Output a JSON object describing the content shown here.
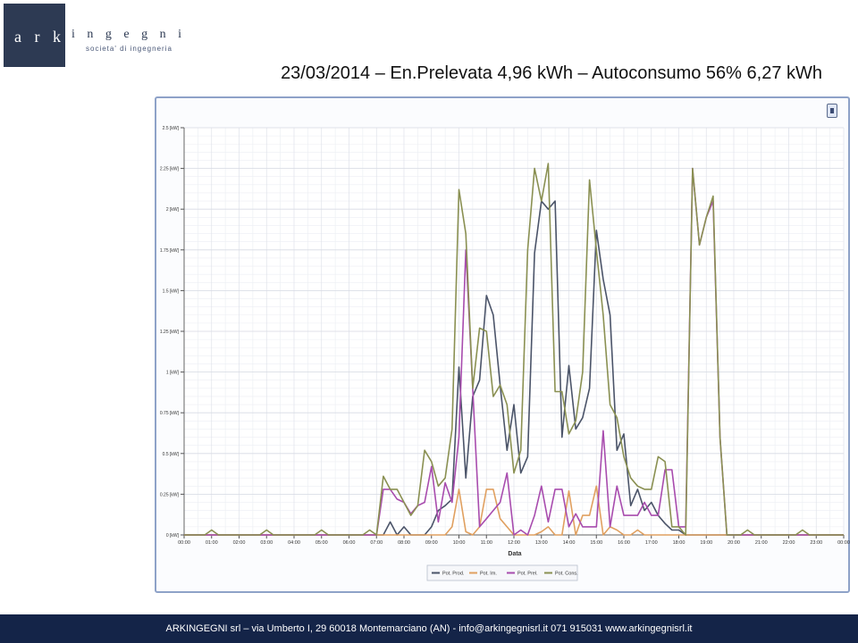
{
  "logo": {
    "text_ark": "a r k",
    "text_ingegni": "i n g e g n i",
    "subtitle": "societa' di ingegneria"
  },
  "title": "23/03/2014 – En.Prelevata 4,96 kWh – Autoconsumo 56% 6,27 kWh",
  "footer": "ARKINGEGNI srl – via Umberto I, 29 60018 Montemarciano (AN) - info@arkingegnisrl.it 071 915031 www.arkingegnisrl.it",
  "chart_data": {
    "type": "line",
    "xlabel": "Data",
    "ylabel": "",
    "ylim": [
      0,
      2.5
    ],
    "xlim": [
      0,
      24
    ],
    "grid": true,
    "legend_position": "bottom-center",
    "x_ticks": [
      "00:00",
      "01:00",
      "02:00",
      "03:00",
      "04:00",
      "05:00",
      "06:00",
      "07:00",
      "08:00",
      "09:00",
      "10:00",
      "11:00",
      "12:00",
      "13:00",
      "14:00",
      "15:00",
      "16:00",
      "17:00",
      "18:00",
      "19:00",
      "20:00",
      "21:00",
      "22:00",
      "23:00",
      "00:00"
    ],
    "y_ticks": [
      {
        "value": 0,
        "label": "0 [kW]"
      },
      {
        "value": 0.25,
        "label": "0.25 [kW]"
      },
      {
        "value": 0.5,
        "label": "0.5 [kW]"
      },
      {
        "value": 0.75,
        "label": "0.75 [kW]"
      },
      {
        "value": 1,
        "label": "1 [kW]"
      },
      {
        "value": 1.25,
        "label": "1.25 [kW]"
      },
      {
        "value": 1.5,
        "label": "1.5 [kW]"
      },
      {
        "value": 1.75,
        "label": "1.75 [kW]"
      },
      {
        "value": 2,
        "label": "2 [kW]"
      },
      {
        "value": 2.25,
        "label": "2.25 [kW]"
      },
      {
        "value": 2.5,
        "label": "2.5 [kW]"
      }
    ],
    "series": [
      {
        "name": "Pot. Prod.",
        "color": "#4b5469",
        "points": [
          [
            0,
            0
          ],
          [
            7,
            0
          ],
          [
            7.25,
            0
          ],
          [
            7.5,
            0.08
          ],
          [
            7.75,
            0
          ],
          [
            8,
            0.05
          ],
          [
            8.25,
            0
          ],
          [
            8.5,
            0
          ],
          [
            8.75,
            0
          ],
          [
            9,
            0.05
          ],
          [
            9.25,
            0.15
          ],
          [
            9.5,
            0.18
          ],
          [
            9.75,
            0.22
          ],
          [
            10,
            1.03
          ],
          [
            10.25,
            0.35
          ],
          [
            10.5,
            0.85
          ],
          [
            10.75,
            0.95
          ],
          [
            11,
            1.47
          ],
          [
            11.25,
            1.35
          ],
          [
            11.5,
            0.92
          ],
          [
            11.75,
            0.52
          ],
          [
            12,
            0.8
          ],
          [
            12.25,
            0.38
          ],
          [
            12.5,
            0.48
          ],
          [
            12.75,
            1.73
          ],
          [
            13,
            2.05
          ],
          [
            13.25,
            2.0
          ],
          [
            13.5,
            2.05
          ],
          [
            13.75,
            0.6
          ],
          [
            14,
            1.04
          ],
          [
            14.25,
            0.65
          ],
          [
            14.5,
            0.72
          ],
          [
            14.75,
            0.9
          ],
          [
            15,
            1.87
          ],
          [
            15.25,
            1.57
          ],
          [
            15.5,
            1.35
          ],
          [
            15.75,
            0.52
          ],
          [
            16,
            0.62
          ],
          [
            16.25,
            0.18
          ],
          [
            16.5,
            0.28
          ],
          [
            16.75,
            0.15
          ],
          [
            17,
            0.2
          ],
          [
            17.25,
            0.12
          ],
          [
            17.5,
            0.07
          ],
          [
            17.75,
            0.03
          ],
          [
            18,
            0.03
          ],
          [
            18.25,
            0
          ],
          [
            24,
            0
          ]
        ]
      },
      {
        "name": "Pot. Im.",
        "color": "#e0a060",
        "points": [
          [
            0,
            0
          ],
          [
            9.5,
            0
          ],
          [
            9.75,
            0.05
          ],
          [
            10,
            0.28
          ],
          [
            10.25,
            0.02
          ],
          [
            10.5,
            0
          ],
          [
            10.75,
            0.05
          ],
          [
            11,
            0.28
          ],
          [
            11.25,
            0.28
          ],
          [
            11.5,
            0.1
          ],
          [
            11.75,
            0.05
          ],
          [
            12,
            0
          ],
          [
            12.25,
            0
          ],
          [
            12.5,
            0
          ],
          [
            12.75,
            0
          ],
          [
            13,
            0.02
          ],
          [
            13.25,
            0.05
          ],
          [
            13.5,
            0
          ],
          [
            13.75,
            0
          ],
          [
            14,
            0.27
          ],
          [
            14.25,
            0
          ],
          [
            14.5,
            0.12
          ],
          [
            14.75,
            0.12
          ],
          [
            15,
            0.3
          ],
          [
            15.25,
            0
          ],
          [
            15.5,
            0.05
          ],
          [
            15.75,
            0.03
          ],
          [
            16,
            0
          ],
          [
            16.25,
            0
          ],
          [
            16.5,
            0.03
          ],
          [
            16.75,
            0
          ],
          [
            17,
            0
          ],
          [
            24,
            0
          ]
        ]
      },
      {
        "name": "Pot. Prel.",
        "color": "#a84cae",
        "points": [
          [
            0,
            0
          ],
          [
            7,
            0
          ],
          [
            7.25,
            0.28
          ],
          [
            7.5,
            0.28
          ],
          [
            7.75,
            0.22
          ],
          [
            8,
            0.2
          ],
          [
            8.25,
            0.13
          ],
          [
            8.5,
            0.18
          ],
          [
            8.75,
            0.2
          ],
          [
            9,
            0.42
          ],
          [
            9.25,
            0.08
          ],
          [
            9.5,
            0.32
          ],
          [
            9.75,
            0.2
          ],
          [
            10,
            0.6
          ],
          [
            10.25,
            1.75
          ],
          [
            10.5,
            0.9
          ],
          [
            10.75,
            0.05
          ],
          [
            11,
            0.1
          ],
          [
            11.25,
            0.15
          ],
          [
            11.5,
            0.2
          ],
          [
            11.75,
            0.38
          ],
          [
            12,
            0
          ],
          [
            12.25,
            0.03
          ],
          [
            12.5,
            0
          ],
          [
            12.75,
            0.12
          ],
          [
            13,
            0.3
          ],
          [
            13.25,
            0.08
          ],
          [
            13.5,
            0.28
          ],
          [
            13.75,
            0.28
          ],
          [
            14,
            0.05
          ],
          [
            14.25,
            0.13
          ],
          [
            14.5,
            0.05
          ],
          [
            14.75,
            0.05
          ],
          [
            15,
            0.05
          ],
          [
            15.25,
            0.64
          ],
          [
            15.5,
            0.05
          ],
          [
            15.75,
            0.3
          ],
          [
            16,
            0.12
          ],
          [
            16.25,
            0.12
          ],
          [
            16.5,
            0.12
          ],
          [
            16.75,
            0.2
          ],
          [
            17,
            0.12
          ],
          [
            17.25,
            0.12
          ],
          [
            17.5,
            0.4
          ],
          [
            17.75,
            0.4
          ],
          [
            18,
            0.05
          ],
          [
            18.25,
            0.05
          ],
          [
            18.5,
            2.25
          ],
          [
            18.75,
            1.78
          ],
          [
            19,
            1.95
          ],
          [
            19.25,
            2.05
          ],
          [
            19.5,
            0.6
          ],
          [
            19.75,
            0
          ],
          [
            24,
            0
          ]
        ]
      },
      {
        "name": "Pot. Cons.",
        "color": "#8a9052",
        "points": [
          [
            0,
            0
          ],
          [
            0.75,
            0
          ],
          [
            1,
            0.03
          ],
          [
            1.25,
            0
          ],
          [
            2.75,
            0
          ],
          [
            3,
            0.03
          ],
          [
            3.25,
            0
          ],
          [
            4.75,
            0
          ],
          [
            5,
            0.03
          ],
          [
            5.25,
            0
          ],
          [
            6.5,
            0
          ],
          [
            6.75,
            0.03
          ],
          [
            7,
            0
          ],
          [
            7.25,
            0.36
          ],
          [
            7.5,
            0.28
          ],
          [
            7.75,
            0.28
          ],
          [
            8,
            0.2
          ],
          [
            8.25,
            0.12
          ],
          [
            8.5,
            0.18
          ],
          [
            8.75,
            0.52
          ],
          [
            9,
            0.45
          ],
          [
            9.25,
            0.3
          ],
          [
            9.5,
            0.35
          ],
          [
            9.75,
            0.65
          ],
          [
            10,
            2.12
          ],
          [
            10.25,
            1.85
          ],
          [
            10.5,
            0.9
          ],
          [
            10.75,
            1.27
          ],
          [
            11,
            1.25
          ],
          [
            11.25,
            0.85
          ],
          [
            11.5,
            0.92
          ],
          [
            11.75,
            0.8
          ],
          [
            12,
            0.38
          ],
          [
            12.25,
            0.52
          ],
          [
            12.5,
            1.75
          ],
          [
            12.75,
            2.25
          ],
          [
            13,
            2.05
          ],
          [
            13.25,
            2.28
          ],
          [
            13.5,
            0.88
          ],
          [
            13.75,
            0.88
          ],
          [
            14,
            0.62
          ],
          [
            14.25,
            0.7
          ],
          [
            14.5,
            1.0
          ],
          [
            14.75,
            2.18
          ],
          [
            15,
            1.75
          ],
          [
            15.25,
            1.35
          ],
          [
            15.5,
            0.8
          ],
          [
            15.75,
            0.72
          ],
          [
            16,
            0.48
          ],
          [
            16.25,
            0.35
          ],
          [
            16.5,
            0.3
          ],
          [
            16.75,
            0.28
          ],
          [
            17,
            0.28
          ],
          [
            17.25,
            0.48
          ],
          [
            17.5,
            0.45
          ],
          [
            17.75,
            0.05
          ],
          [
            18,
            0.05
          ],
          [
            18.25,
            0
          ],
          [
            18.5,
            2.25
          ],
          [
            18.75,
            1.78
          ],
          [
            19,
            1.95
          ],
          [
            19.25,
            2.08
          ],
          [
            19.5,
            0.6
          ],
          [
            19.75,
            0
          ],
          [
            20.25,
            0
          ],
          [
            20.5,
            0.03
          ],
          [
            20.75,
            0
          ],
          [
            22.25,
            0
          ],
          [
            22.5,
            0.03
          ],
          [
            22.75,
            0
          ],
          [
            24,
            0
          ]
        ]
      }
    ]
  }
}
